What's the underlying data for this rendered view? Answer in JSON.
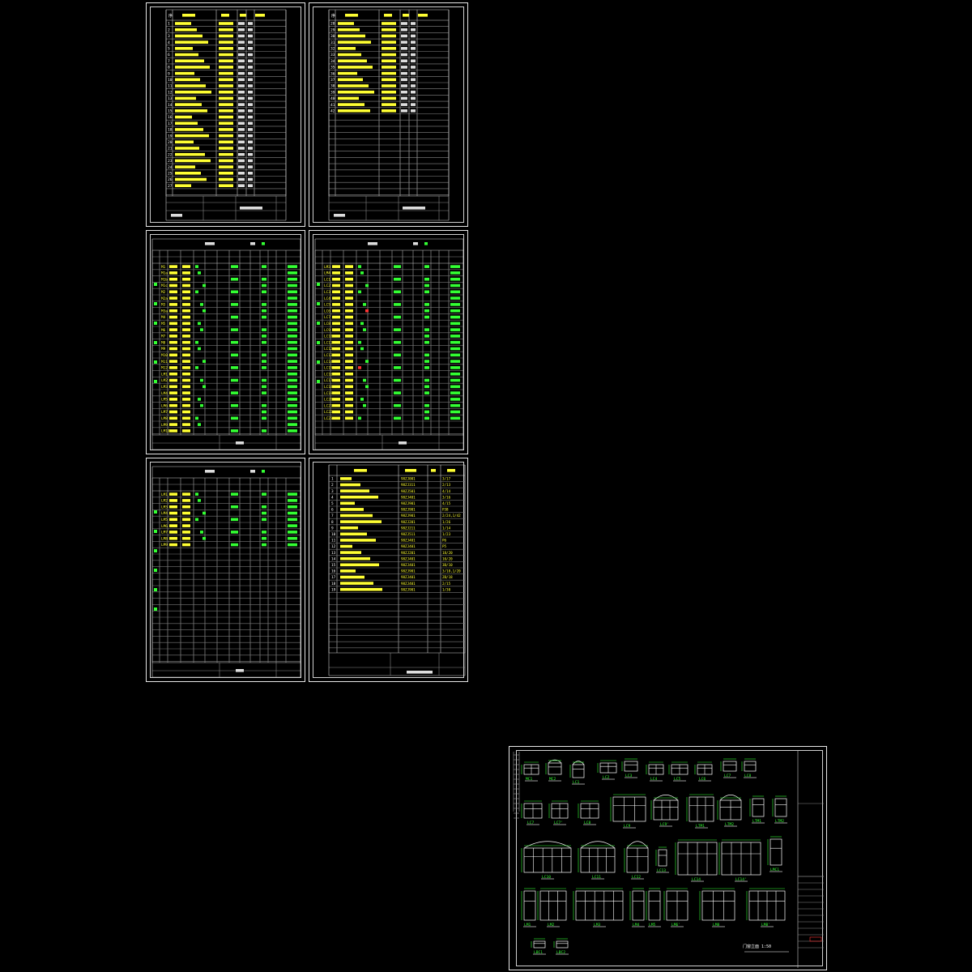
{
  "colors": {
    "background": "#000000",
    "frame": "#e8e8e8",
    "text_yellow": "#ffff33",
    "text_green": "#33ff33",
    "text_red": "#ff3333",
    "text_white": "#ffffff"
  },
  "sheets": {
    "drawing_list_1": {
      "row_numbers": [
        "1",
        "2",
        "3",
        "4",
        "5",
        "6",
        "7",
        "8",
        "9",
        "10",
        "11",
        "12",
        "13",
        "14",
        "15",
        "16",
        "17",
        "18",
        "19",
        "20",
        "21",
        "22",
        "23",
        "24",
        "25",
        "26",
        "27"
      ]
    },
    "drawing_list_2": {
      "row_numbers": [
        "28",
        "29",
        "30",
        "31",
        "32",
        "33",
        "34",
        "35",
        "36",
        "37",
        "38",
        "39",
        "40",
        "41",
        "42"
      ]
    },
    "door_window_table_1": {
      "codes": [
        "M1",
        "M1a",
        "M1b",
        "M1c",
        "M2",
        "M2a",
        "M3",
        "M3a",
        "M4",
        "M5",
        "M6",
        "M7",
        "M8",
        "M9",
        "M10",
        "M11",
        "M12",
        "LM1",
        "LM2",
        "LM3",
        "LM4",
        "LM5",
        "LM6",
        "LM7",
        "LM8",
        "LM9",
        "LM10",
        "LM11",
        "LM12"
      ]
    },
    "door_window_table_2": {
      "codes": [
        "LM3",
        "LM4",
        "LC1",
        "LC2",
        "LC3",
        "LC4",
        "LC5",
        "LC6",
        "LC7",
        "LC8",
        "LC9",
        "LC10",
        "LC11",
        "LC12",
        "LC13",
        "LC14",
        "LC15",
        "LC16",
        "LC17",
        "LC18",
        "LC19",
        "LC20",
        "LC21",
        "LC22",
        "LC23"
      ]
    },
    "door_window_table_3": {
      "codes": [
        "LM1",
        "LM2",
        "LM3",
        "LM4",
        "LM5",
        "LM6",
        "LM7",
        "LM8",
        "LM9"
      ]
    },
    "standard_drawings": {
      "rows": [
        {
          "no": "1",
          "code": "98ZJ001",
          "page": "3/17"
        },
        {
          "no": "2",
          "code": "98ZJ311",
          "page": "2/13"
        },
        {
          "no": "3",
          "code": "98ZJ501",
          "page": "4/14"
        },
        {
          "no": "4",
          "code": "98ZJ401",
          "page": "3/16"
        },
        {
          "no": "5",
          "code": "98ZJ901",
          "page": "4/15"
        },
        {
          "no": "6",
          "code": "98ZJ901",
          "page": "P38"
        },
        {
          "no": "7",
          "code": "98ZJ901",
          "page": "2/24,1/42"
        },
        {
          "no": "8",
          "code": "98ZJ201",
          "page": "1/26"
        },
        {
          "no": "9",
          "code": "98ZJ211",
          "page": "1/14"
        },
        {
          "no": "10",
          "code": "98ZJ511",
          "page": "1/23"
        },
        {
          "no": "11",
          "code": "98ZJ401",
          "page": "P6"
        },
        {
          "no": "12",
          "code": "98ZJ401",
          "page": "P5"
        },
        {
          "no": "13",
          "code": "98ZJ201",
          "page": "18/20"
        },
        {
          "no": "14",
          "code": "98ZJ401",
          "page": "10/20"
        },
        {
          "no": "15",
          "code": "98ZJ401",
          "page": "3B/10"
        },
        {
          "no": "16",
          "code": "98ZJ901",
          "page": "3/18,1/20"
        },
        {
          "no": "17",
          "code": "98ZJ401",
          "page": "2B/18"
        },
        {
          "no": "18",
          "code": "98ZJ401",
          "page": "2/15"
        },
        {
          "no": "19",
          "code": "98ZJ901",
          "page": "1/30"
        }
      ]
    },
    "elevations": {
      "row1": [
        "MC1",
        "MC2",
        "LC1",
        "LC2",
        "LC3",
        "LC4",
        "LC5",
        "LC6",
        "LC7",
        "LC8"
      ],
      "row2": [
        "LC7",
        "LC7'",
        "LC8",
        "LC9",
        "LC9'",
        "LTM1",
        "LTM2"
      ],
      "row3": [
        "LC10",
        "LC11",
        "LC12",
        "LC13",
        "LC14",
        "LC14'",
        "LMC1"
      ],
      "row4": [
        "LM1",
        "LM2",
        "LM3",
        "LM4",
        "LM5",
        "LM6'",
        "LM8",
        "LM8'"
      ],
      "row5": [
        "LBC1",
        "LBC2"
      ],
      "scale_note": "门窗立面 1:50"
    }
  }
}
